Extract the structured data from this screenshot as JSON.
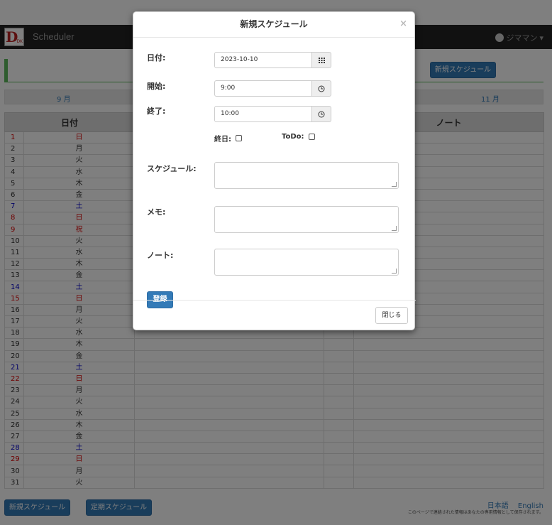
{
  "navbar": {
    "brand": "Scheduler",
    "user_name": "ジママン",
    "logo_letter": "D",
    "logo_sub": "DK"
  },
  "toolbar": {
    "new_schedule_top": "新規スケジュール"
  },
  "month_nav": {
    "prev": "9 月",
    "next": "11 月"
  },
  "table": {
    "headers": [
      "日付",
      "",
      "",
      "ノート"
    ],
    "days": [
      {
        "d": "1",
        "w": "日",
        "c": "red"
      },
      {
        "d": "2",
        "w": "月",
        "c": ""
      },
      {
        "d": "3",
        "w": "火",
        "c": ""
      },
      {
        "d": "4",
        "w": "水",
        "c": ""
      },
      {
        "d": "5",
        "w": "木",
        "c": ""
      },
      {
        "d": "6",
        "w": "金",
        "c": ""
      },
      {
        "d": "7",
        "w": "土",
        "c": "blue"
      },
      {
        "d": "8",
        "w": "日",
        "c": "red"
      },
      {
        "d": "9",
        "w": "祝",
        "c": "red"
      },
      {
        "d": "10",
        "w": "火",
        "c": ""
      },
      {
        "d": "11",
        "w": "水",
        "c": ""
      },
      {
        "d": "12",
        "w": "木",
        "c": ""
      },
      {
        "d": "13",
        "w": "金",
        "c": ""
      },
      {
        "d": "14",
        "w": "土",
        "c": "blue"
      },
      {
        "d": "15",
        "w": "日",
        "c": "red"
      },
      {
        "d": "16",
        "w": "月",
        "c": ""
      },
      {
        "d": "17",
        "w": "火",
        "c": ""
      },
      {
        "d": "18",
        "w": "水",
        "c": ""
      },
      {
        "d": "19",
        "w": "木",
        "c": ""
      },
      {
        "d": "20",
        "w": "金",
        "c": ""
      },
      {
        "d": "21",
        "w": "土",
        "c": "blue"
      },
      {
        "d": "22",
        "w": "日",
        "c": "red"
      },
      {
        "d": "23",
        "w": "月",
        "c": ""
      },
      {
        "d": "24",
        "w": "火",
        "c": ""
      },
      {
        "d": "25",
        "w": "水",
        "c": ""
      },
      {
        "d": "26",
        "w": "木",
        "c": ""
      },
      {
        "d": "27",
        "w": "金",
        "c": ""
      },
      {
        "d": "28",
        "w": "土",
        "c": "blue"
      },
      {
        "d": "29",
        "w": "日",
        "c": "red"
      },
      {
        "d": "30",
        "w": "月",
        "c": ""
      },
      {
        "d": "31",
        "w": "火",
        "c": ""
      }
    ]
  },
  "bottom": {
    "new_schedule": "新規スケジュール",
    "recurring_schedule": "定期スケジュール"
  },
  "footer": {
    "lang_ja": "日本語",
    "lang_en": "English",
    "note": "このページで連絡された情報はあなたの専用情報として保存されます。"
  },
  "modal": {
    "title": "新規スケジュール",
    "close_x": "×",
    "date_label": "日付:",
    "date_value": "2023-10-10",
    "start_label": "開始:",
    "start_value": "9:00",
    "end_label": "終了:",
    "end_value": "10:00",
    "allday_label": "終日:",
    "todo_label": "ToDo:",
    "schedule_label": "スケジュール:",
    "memo_label": "メモ:",
    "note_label": "ノート:",
    "register_button": "登録",
    "close_button": "閉じる"
  },
  "colors": {
    "accent": "#337ab7",
    "holiday": "#d00",
    "saturday": "#00c",
    "title_border": "#5cb85c"
  }
}
